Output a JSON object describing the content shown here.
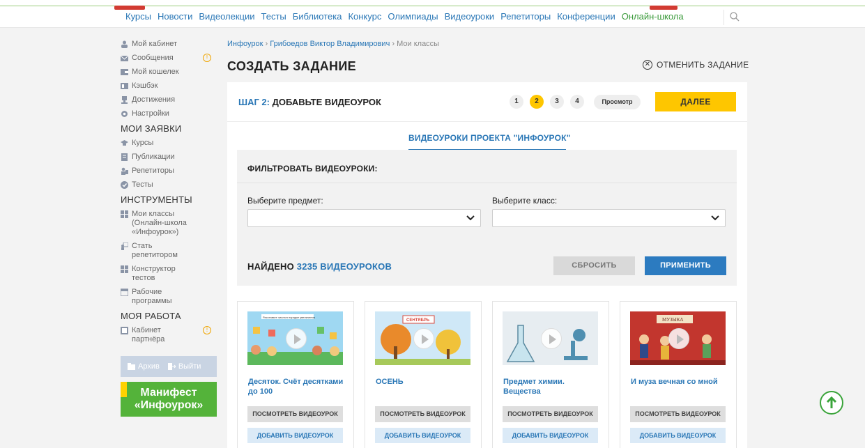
{
  "nav": {
    "items": [
      "Курсы",
      "Новости",
      "Видеолекции",
      "Тесты",
      "Библиотека",
      "Конкурс",
      "Олимпиады",
      "Видеоуроки",
      "Репетиторы",
      "Конференции"
    ],
    "highlight_item": "Онлайн-школа"
  },
  "sidebar": {
    "items": [
      {
        "label": "Мой кабинет",
        "icon": "user-icon"
      },
      {
        "label": "Сообщения",
        "icon": "envelope-icon",
        "warn": "!"
      },
      {
        "label": "Мой кошелек",
        "icon": "wallet-icon"
      },
      {
        "label": "Кэшбэк",
        "icon": "cashback-icon"
      },
      {
        "label": "Достижения",
        "icon": "trophy-icon"
      },
      {
        "label": "Настройки",
        "icon": "gear-icon"
      }
    ],
    "requests_head": "МОИ ЗАЯВКИ",
    "requests": [
      {
        "label": "Курсы",
        "icon": "graduation-cap-icon"
      },
      {
        "label": "Публикации",
        "icon": "document-icon"
      },
      {
        "label": "Репетиторы",
        "icon": "tutor-icon"
      },
      {
        "label": "Тесты",
        "icon": "check-circle-icon"
      }
    ],
    "tools_head": "ИНСТРУМЕНТЫ",
    "tools": [
      {
        "label": "Мои классы (Онлайн-школа «Инфоурок»)",
        "icon": "classes-icon"
      },
      {
        "label": "Стать репетитором",
        "icon": "become-tutor-icon"
      },
      {
        "label": "Конструктор тестов",
        "icon": "grid-icon"
      },
      {
        "label": "Рабочие программы",
        "icon": "calendar-icon"
      }
    ],
    "work_head": "МОЯ РАБОТА",
    "work": [
      {
        "label": "Кабинет партнёра",
        "icon": "partner-icon",
        "warn": "!"
      }
    ],
    "archive": "Архив",
    "logout": "Выйти",
    "manifest_line1": "Манифест",
    "manifest_line2": "«Инфоурок»"
  },
  "breadcrumb": {
    "home": "Инфоурок",
    "sep1": "›",
    "user": "Грибоедов Виктор Владимирович",
    "sep2": "›",
    "current": "Мои классы"
  },
  "page": {
    "title": "СОЗДАТЬ ЗАДАНИЕ",
    "cancel": "ОТМЕНИТЬ ЗАДАНИЕ"
  },
  "wizard": {
    "step_prefix": "ШАГ 2:",
    "step_title": "ДОБАВЬТЕ ВИДЕОУРОК",
    "steps": [
      "1",
      "2",
      "3",
      "4"
    ],
    "active_step": "2",
    "preview": "Просмотр",
    "next": "ДАЛЕЕ"
  },
  "tab": {
    "label": "ВИДЕОУРОКИ ПРОЕКТА \"ИНФОУРОК\""
  },
  "filter": {
    "title": "ФИЛЬТРОВАТЬ ВИДЕОУРОКИ:",
    "subject_label": "Выберите предмет:",
    "subject_value": "",
    "class_label": "Выберите класс:",
    "class_value": "",
    "found_prefix": "НАЙДЕНО",
    "found_count": "3235 ВИДЕОУРОКОВ",
    "reset": "СБРОСИТЬ",
    "apply": "ПРИМЕНИТЬ"
  },
  "videos": [
    {
      "title": "Десяток. Счёт десятками до 100",
      "thumb_caption": "Расставьте числа в порядке увеличения",
      "view": "ПОСМОТРЕТЬ ВИДЕОУРОК",
      "add": "ДОБАВИТЬ ВИДЕОУРОК"
    },
    {
      "title": "ОСЕНЬ",
      "thumb_caption": "СЕНТЯБРЬ",
      "view": "ПОСМОТРЕТЬ ВИДЕОУРОК",
      "add": "ДОБАВИТЬ ВИДЕОУРОК"
    },
    {
      "title": "Предмет химии. Вещества",
      "thumb_caption": "",
      "view": "ПОСМОТРЕТЬ ВИДЕОУРОК",
      "add": "ДОБАВИТЬ ВИДЕОУРОК"
    },
    {
      "title": "И муза вечная со мной",
      "thumb_caption": "МУЗЫКА",
      "view": "ПОСМОТРЕТЬ ВИДЕОУРОК",
      "add": "ДОБАВИТЬ ВИДЕОУРОК"
    }
  ],
  "colors": {
    "accent_blue": "#2a77b6",
    "accent_yellow": "#fec600",
    "green": "#54b33a"
  }
}
